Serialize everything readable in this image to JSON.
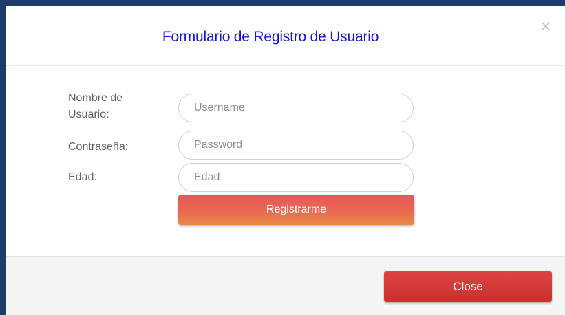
{
  "modal": {
    "title": "Formulario de Registro de Usuario",
    "close_icon": "close-x-icon"
  },
  "form": {
    "username_label_line1": "Nombre de",
    "username_label_line2": "Usuario:",
    "username_placeholder": "Username",
    "username_value": "",
    "password_label": "Contraseña:",
    "password_placeholder": "Password",
    "password_value": "",
    "age_label": "Edad:",
    "age_placeholder": "Edad",
    "age_value": "",
    "register_label": "Registrarme"
  },
  "footer": {
    "close_label": "Close"
  },
  "colors": {
    "title": "#1414d2",
    "register_button": "#e86a52",
    "close_button": "#c9302c",
    "backdrop": "#1e3c67"
  }
}
